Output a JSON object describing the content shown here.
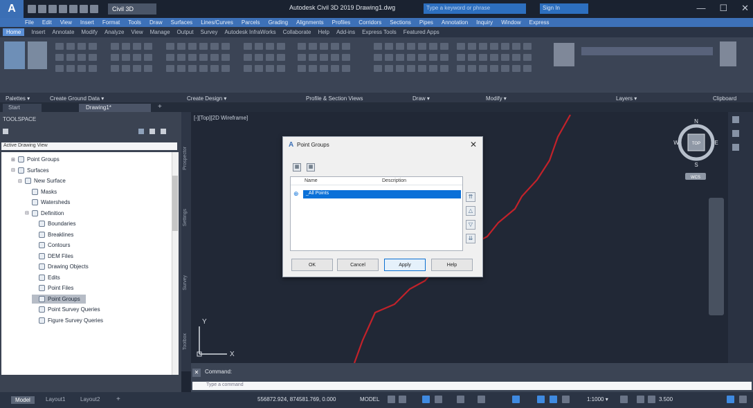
{
  "titlebar": {
    "workspace": "Civil 3D",
    "title": "Autodesk Civil 3D 2019   Drawing1.dwg",
    "search_placeholder": "Type a keyword or phrase",
    "signin": "Sign In"
  },
  "menubar": [
    "File",
    "Edit",
    "View",
    "Insert",
    "Format",
    "Tools",
    "Draw",
    "Surfaces",
    "Lines/Curves",
    "Parcels",
    "Grading",
    "Alignments",
    "Profiles",
    "Corridors",
    "Sections",
    "Pipes",
    "Annotation",
    "Inquiry",
    "Window",
    "Express"
  ],
  "ribbon_tabs": [
    "Home",
    "Insert",
    "Annotate",
    "Modify",
    "Analyze",
    "View",
    "Manage",
    "Output",
    "Survey",
    "Autodesk InfraWorks",
    "Collaborate",
    "Help",
    "Add-ins",
    "Express Tools",
    "Featured Apps"
  ],
  "ribbon_panels": [
    "Palettes ▾",
    "Create Ground Data ▾",
    "Create Design ▾",
    "Profile & Section Views",
    "Draw ▾",
    "Modify ▾",
    "Layers ▾",
    "Clipboard"
  ],
  "doc_tabs": {
    "start": "Start",
    "drawing": "Drawing1*",
    "add": "+"
  },
  "toolspace": {
    "title": "TOOLSPACE",
    "view": "Active Drawing View",
    "tree": [
      {
        "label": "Point Groups",
        "indent": 1,
        "twisty": "⊞"
      },
      {
        "label": "Surfaces",
        "indent": 1,
        "twisty": "⊟"
      },
      {
        "label": "New Surface",
        "indent": 2,
        "twisty": "⊟"
      },
      {
        "label": "Masks",
        "indent": 3,
        "twisty": ""
      },
      {
        "label": "Watersheds",
        "indent": 3,
        "twisty": ""
      },
      {
        "label": "Definition",
        "indent": 3,
        "twisty": "⊟"
      },
      {
        "label": "Boundaries",
        "indent": 4,
        "twisty": ""
      },
      {
        "label": "Breaklines",
        "indent": 4,
        "twisty": ""
      },
      {
        "label": "Contours",
        "indent": 4,
        "twisty": ""
      },
      {
        "label": "DEM Files",
        "indent": 4,
        "twisty": ""
      },
      {
        "label": "Drawing Objects",
        "indent": 4,
        "twisty": ""
      },
      {
        "label": "Edits",
        "indent": 4,
        "twisty": ""
      },
      {
        "label": "Point Files",
        "indent": 4,
        "twisty": ""
      },
      {
        "label": "Point Groups",
        "indent": 4,
        "twisty": "",
        "selected": true
      },
      {
        "label": "Point Survey Queries",
        "indent": 4,
        "twisty": ""
      },
      {
        "label": "Figure Survey Queries",
        "indent": 4,
        "twisty": ""
      }
    ],
    "side_tabs": [
      "Prospector",
      "Settings",
      "Survey",
      "Toolbox"
    ]
  },
  "viewport": {
    "label": "[-][Top][2D Wireframe]",
    "viewcube_face": "TOP",
    "wcs": "WCS",
    "compass": [
      "N",
      "S",
      "W",
      "E"
    ],
    "ucs_x": "X",
    "ucs_y": "Y",
    "colors": {
      "background": "#212836",
      "alignment": "#c2222a"
    }
  },
  "dialog": {
    "title": "Point Groups",
    "close": "✕",
    "col_name": "Name",
    "col_description": "Description",
    "rows": [
      "_All Points"
    ],
    "buttons": {
      "ok": "OK",
      "cancel": "Cancel",
      "apply": "Apply",
      "help": "Help"
    }
  },
  "command": {
    "history": "Command:",
    "placeholder": "Type a command"
  },
  "statusbar": {
    "model_tab": "Model",
    "layout1": "Layout1",
    "layout2": "Layout2",
    "add": "+",
    "coords": "556872.924, 874581.769, 0.000",
    "model": "MODEL",
    "scale": "1:1000 ▾",
    "zoom": "3.500"
  }
}
